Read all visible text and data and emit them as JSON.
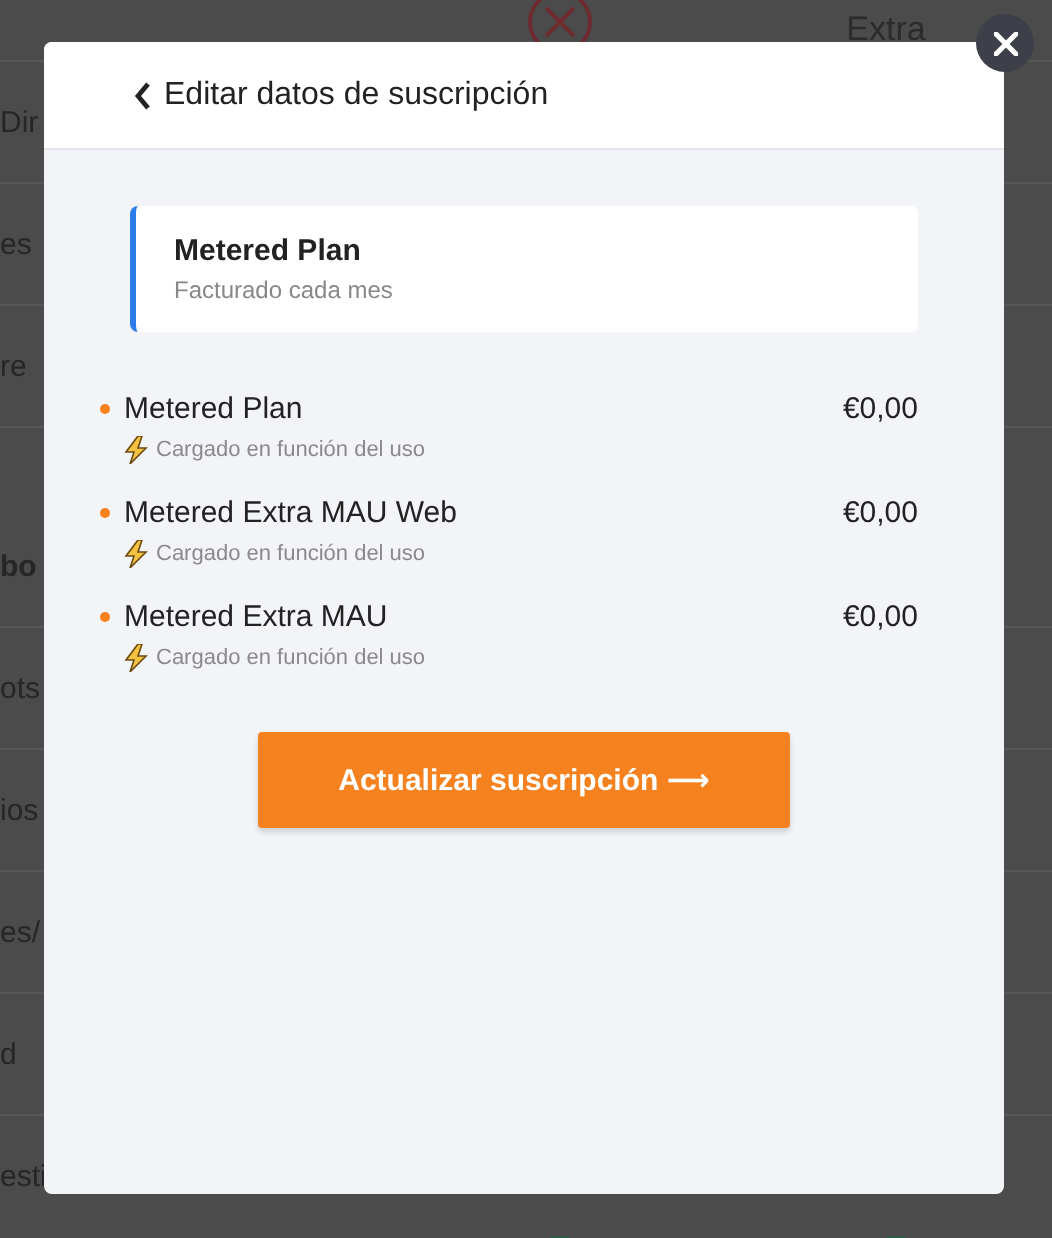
{
  "background": {
    "header": {
      "column_3": "Extra"
    },
    "rows": [
      {
        "label": "Dir",
        "kind": "item"
      },
      {
        "label": "es",
        "kind": "item"
      },
      {
        "label": "re",
        "kind": "item"
      },
      {
        "label": "bo",
        "kind": "section"
      },
      {
        "label": "ots",
        "kind": "item"
      },
      {
        "label": "ios",
        "kind": "item"
      },
      {
        "label": "es/",
        "kind": "item"
      },
      {
        "label": "d",
        "kind": "item"
      },
      {
        "label": "esti",
        "kind": "item"
      }
    ]
  },
  "modal": {
    "title": "Editar datos de suscripción",
    "plan": {
      "name": "Metered Plan",
      "billing": "Facturado cada mes"
    },
    "items": [
      {
        "name": "Metered Plan",
        "price": "€0,00",
        "note": "Cargado en función del uso"
      },
      {
        "name": "Metered Extra MAU Web",
        "price": "€0,00",
        "note": "Cargado en función del uso"
      },
      {
        "name": "Metered Extra MAU",
        "price": "€0,00",
        "note": "Cargado en función del uso"
      }
    ],
    "button": "Actualizar suscripción ⟶"
  }
}
